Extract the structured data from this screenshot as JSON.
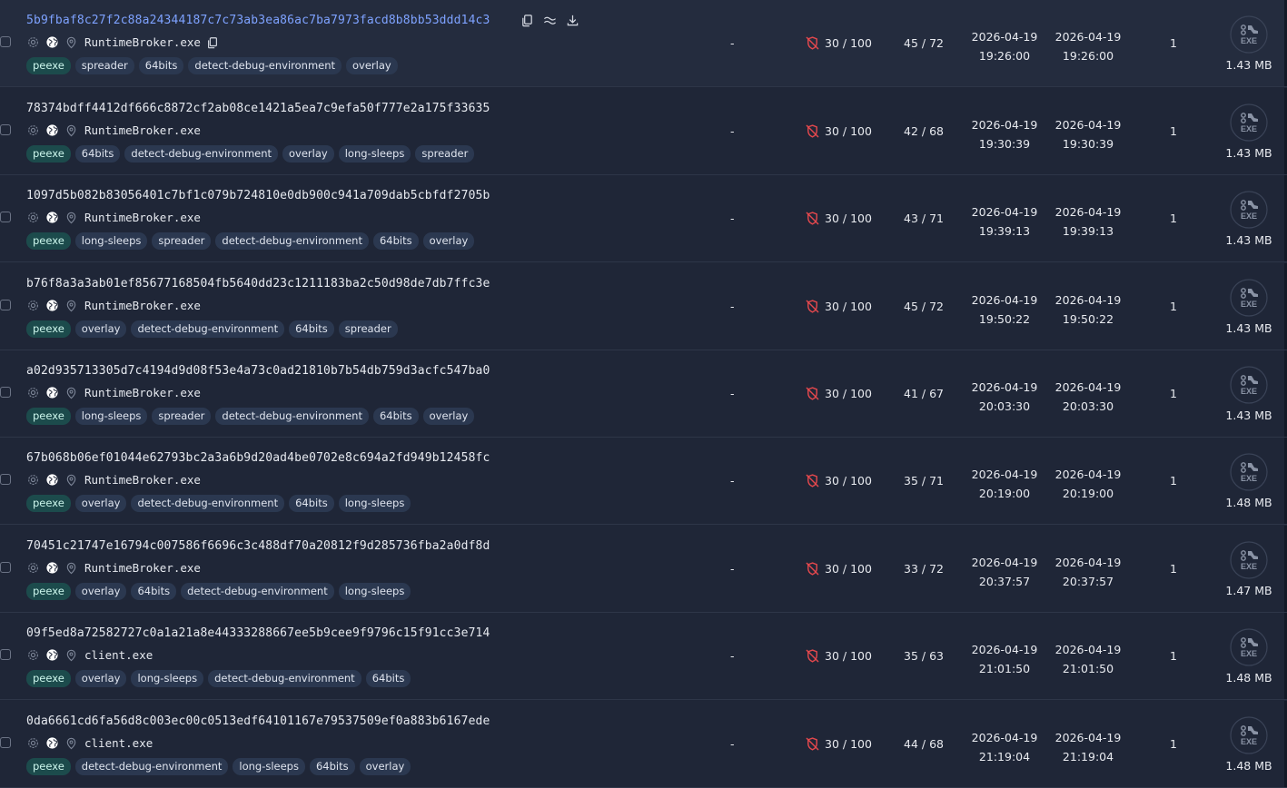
{
  "colors": {
    "background": "#1f2637",
    "row_hover": "#242c3e",
    "hash_link": "#7ea2ff",
    "tag_bg": "#2b3850",
    "tag_primary_bg": "#1c4b4c",
    "score_icon": "#e5484d"
  },
  "icons": {
    "hash_actions": [
      "copy-icon",
      "similar-icon",
      "download-icon"
    ],
    "meta": [
      "gear-icon",
      "globe-icon",
      "location-pin-icon"
    ],
    "score": "shield-off-icon",
    "filetype": "exe-file-icon"
  },
  "rows": [
    {
      "sha256": "5b9fbaf8c27f2c88a24344187c7c73ab3ea86ac7ba7973facd8b8bb53ddd14c3",
      "filename": "RuntimeBroker.exe",
      "tags": [
        "peexe",
        "spreader",
        "64bits",
        "detect-debug-environment",
        "overlay"
      ],
      "col_dash": "-",
      "score": "30 / 100",
      "detections": "45 / 72",
      "first_seen_date": "2026-04-19",
      "first_seen_time": "19:26:00",
      "last_seen_date": "2026-04-19",
      "last_seen_time": "19:26:00",
      "count": "1",
      "filetype_label": "EXE",
      "size": "1.43 MB"
    },
    {
      "sha256": "78374bdff4412df666c8872cf2ab08ce1421a5ea7c9efa50f777e2a175f33635",
      "filename": "RuntimeBroker.exe",
      "tags": [
        "peexe",
        "64bits",
        "detect-debug-environment",
        "overlay",
        "long-sleeps",
        "spreader"
      ],
      "col_dash": "-",
      "score": "30 / 100",
      "detections": "42 / 68",
      "first_seen_date": "2026-04-19",
      "first_seen_time": "19:30:39",
      "last_seen_date": "2026-04-19",
      "last_seen_time": "19:30:39",
      "count": "1",
      "filetype_label": "EXE",
      "size": "1.43 MB"
    },
    {
      "sha256": "1097d5b082b83056401c7bf1c079b724810e0db900c941a709dab5cbfdf2705b",
      "filename": "RuntimeBroker.exe",
      "tags": [
        "peexe",
        "long-sleeps",
        "spreader",
        "detect-debug-environment",
        "64bits",
        "overlay"
      ],
      "col_dash": "-",
      "score": "30 / 100",
      "detections": "43 / 71",
      "first_seen_date": "2026-04-19",
      "first_seen_time": "19:39:13",
      "last_seen_date": "2026-04-19",
      "last_seen_time": "19:39:13",
      "count": "1",
      "filetype_label": "EXE",
      "size": "1.43 MB"
    },
    {
      "sha256": "b76f8a3a3ab01ef85677168504fb5640dd23c1211183ba2c50d98de7db7ffc3e",
      "filename": "RuntimeBroker.exe",
      "tags": [
        "peexe",
        "overlay",
        "detect-debug-environment",
        "64bits",
        "spreader"
      ],
      "col_dash": "-",
      "score": "30 / 100",
      "detections": "45 / 72",
      "first_seen_date": "2026-04-19",
      "first_seen_time": "19:50:22",
      "last_seen_date": "2026-04-19",
      "last_seen_time": "19:50:22",
      "count": "1",
      "filetype_label": "EXE",
      "size": "1.43 MB"
    },
    {
      "sha256": "a02d935713305d7c4194d9d08f53e4a73c0ad21810b7b54db759d3acfc547ba0",
      "filename": "RuntimeBroker.exe",
      "tags": [
        "peexe",
        "long-sleeps",
        "spreader",
        "detect-debug-environment",
        "64bits",
        "overlay"
      ],
      "col_dash": "-",
      "score": "30 / 100",
      "detections": "41 / 67",
      "first_seen_date": "2026-04-19",
      "first_seen_time": "20:03:30",
      "last_seen_date": "2026-04-19",
      "last_seen_time": "20:03:30",
      "count": "1",
      "filetype_label": "EXE",
      "size": "1.43 MB"
    },
    {
      "sha256": "67b068b06ef01044e62793bc2a3a6b9d20ad4be0702e8c694a2fd949b12458fc",
      "filename": "RuntimeBroker.exe",
      "tags": [
        "peexe",
        "overlay",
        "detect-debug-environment",
        "64bits",
        "long-sleeps"
      ],
      "col_dash": "-",
      "score": "30 / 100",
      "detections": "35 / 71",
      "first_seen_date": "2026-04-19",
      "first_seen_time": "20:19:00",
      "last_seen_date": "2026-04-19",
      "last_seen_time": "20:19:00",
      "count": "1",
      "filetype_label": "EXE",
      "size": "1.48 MB"
    },
    {
      "sha256": "70451c21747e16794c007586f6696c3c488df70a20812f9d285736fba2a0df8d",
      "filename": "RuntimeBroker.exe",
      "tags": [
        "peexe",
        "overlay",
        "64bits",
        "detect-debug-environment",
        "long-sleeps"
      ],
      "col_dash": "-",
      "score": "30 / 100",
      "detections": "33 / 72",
      "first_seen_date": "2026-04-19",
      "first_seen_time": "20:37:57",
      "last_seen_date": "2026-04-19",
      "last_seen_time": "20:37:57",
      "count": "1",
      "filetype_label": "EXE",
      "size": "1.47 MB"
    },
    {
      "sha256": "09f5ed8a72582727c0a1a21a8e44333288667ee5b9cee9f9796c15f91cc3e714",
      "filename": "client.exe",
      "tags": [
        "peexe",
        "overlay",
        "long-sleeps",
        "detect-debug-environment",
        "64bits"
      ],
      "col_dash": "-",
      "score": "30 / 100",
      "detections": "35 / 63",
      "first_seen_date": "2026-04-19",
      "first_seen_time": "21:01:50",
      "last_seen_date": "2026-04-19",
      "last_seen_time": "21:01:50",
      "count": "1",
      "filetype_label": "EXE",
      "size": "1.48 MB"
    },
    {
      "sha256": "0da6661cd6fa56d8c003ec00c0513edf64101167e79537509ef0a883b6167ede",
      "filename": "client.exe",
      "tags": [
        "peexe",
        "detect-debug-environment",
        "long-sleeps",
        "64bits",
        "overlay"
      ],
      "col_dash": "-",
      "score": "30 / 100",
      "detections": "44 / 68",
      "first_seen_date": "2026-04-19",
      "first_seen_time": "21:19:04",
      "last_seen_date": "2026-04-19",
      "last_seen_time": "21:19:04",
      "count": "1",
      "filetype_label": "EXE",
      "size": "1.48 MB"
    }
  ]
}
